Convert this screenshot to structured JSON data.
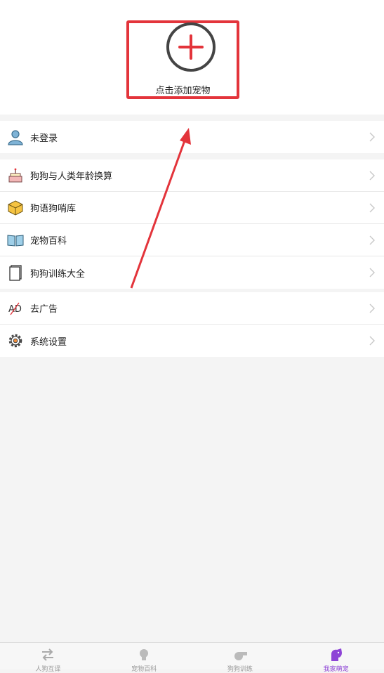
{
  "header": {
    "add_pet_label": "点击添加宠物"
  },
  "account": {
    "login_status": "未登录"
  },
  "features": [
    {
      "label": "狗狗与人类年龄换算",
      "icon": "birthday-cake-icon"
    },
    {
      "label": "狗语狗哨库",
      "icon": "box-icon"
    },
    {
      "label": "宠物百科",
      "icon": "open-book-icon"
    },
    {
      "label": "狗狗训练大全",
      "icon": "notebook-icon"
    }
  ],
  "settings": [
    {
      "label": "去广告",
      "icon": "no-ad-icon"
    },
    {
      "label": "系统设置",
      "icon": "gear-icon"
    }
  ],
  "tabbar": {
    "tabs": [
      {
        "label": "人狗互译",
        "icon": "swap-icon"
      },
      {
        "label": "宠物百科",
        "icon": "bulb-icon"
      },
      {
        "label": "狗狗训练",
        "icon": "whistle-icon"
      },
      {
        "label": "我家萌宠",
        "icon": "dog-icon"
      }
    ],
    "active_color": "#8e44d6"
  },
  "colors": {
    "highlight": "#e3343b",
    "background": "#f4f4f4"
  }
}
